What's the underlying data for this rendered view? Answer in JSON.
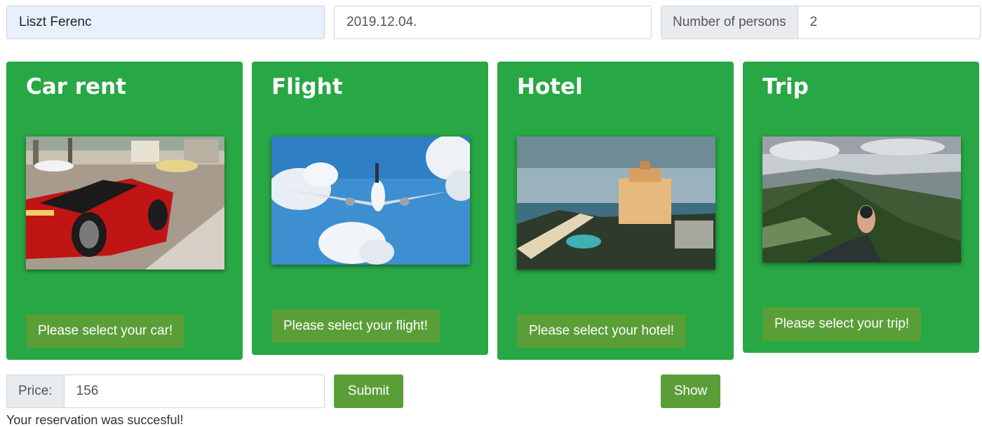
{
  "form": {
    "name_value": "Liszt Ferenc",
    "date_value": "2019.12.04.",
    "persons_label": "Number of persons",
    "persons_value": "2"
  },
  "cards": [
    {
      "title": "Car rent",
      "button_label": "Please select your car!",
      "image": "red-convertible-car-photo"
    },
    {
      "title": "Flight",
      "button_label": "Please select your flight!",
      "image": "airplane-in-sky-photo"
    },
    {
      "title": "Hotel",
      "button_label": "Please select your hotel!",
      "image": "beach-hotel-photo"
    },
    {
      "title": "Trip",
      "button_label": "Please select your trip!",
      "image": "mountain-compass-photo"
    }
  ],
  "bottom": {
    "price_label": "Price:",
    "price_value": "156",
    "submit_label": "Submit",
    "show_label": "Show",
    "status_message": "Your reservation was succesful!"
  },
  "colors": {
    "card_green": "#28a745",
    "button_green": "#5a9e38",
    "autofill_blue": "#e8f0fe"
  }
}
